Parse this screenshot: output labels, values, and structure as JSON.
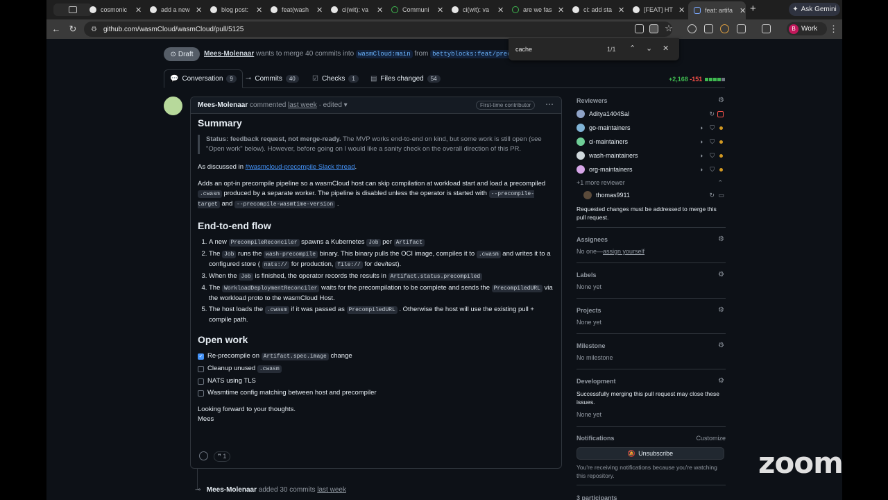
{
  "browser": {
    "tabs": [
      {
        "label": "cosmonic"
      },
      {
        "label": "add a new"
      },
      {
        "label": "blog post:"
      },
      {
        "label": "feat(wash"
      },
      {
        "label": "ci(wit): va"
      },
      {
        "label": "Communi"
      },
      {
        "label": "ci(wit): va"
      },
      {
        "label": "are we fas"
      },
      {
        "label": "ci: add sta"
      },
      {
        "label": "[FEAT] HT"
      },
      {
        "label": "feat: artifa"
      }
    ],
    "gemini_label": "Ask Gemini",
    "url": "github.com/wasmCloud/wasmCloud/pull/5125",
    "profile_initial": "B",
    "profile_label": "Work"
  },
  "find": {
    "query": "cache",
    "count": "1/1"
  },
  "pr": {
    "state": "Draft",
    "author": "Mees-Molenaar",
    "merge_text": "wants to merge 40 commits into",
    "base": "wasmCloud:main",
    "from_text": "from",
    "head": "bettyblocks:feat/precompi",
    "tabs": [
      {
        "label": "Conversation",
        "count": "9",
        "icon": "conversation-icon"
      },
      {
        "label": "Commits",
        "count": "40",
        "icon": "commits-icon"
      },
      {
        "label": "Checks",
        "count": "1",
        "icon": "checks-icon"
      },
      {
        "label": "Files changed",
        "count": "54",
        "icon": "files-icon"
      }
    ],
    "additions": "+2,168",
    "deletions": "-151"
  },
  "comment": {
    "author": "Mees-Molenaar",
    "action": "commented",
    "when": "last week",
    "edited": "· edited",
    "badge": "First-time contributor",
    "summary_title": "Summary",
    "status_bold": "Status: feedback request, not merge-ready.",
    "status_rest": " The MVP works end-to-end on kind, but some work is still open (see \"Open work\" below). However, before going on I would like a sanity check on the overall direction of this PR.",
    "discussed_prefix": "As discussed in ",
    "discussed_link": "#wasmcloud-precompile Slack thread",
    "discussed_suffix": ".",
    "intro_a": "Adds an opt-in precompile pipeline so a wasmCloud host can skip compilation at workload start and load a precompiled ",
    "intro_code1": ".cwasm",
    "intro_b": " produced by a separate worker. The pipeline is disabled unless the operator is started with ",
    "intro_code2": "--precompile-target",
    "intro_c": " and ",
    "intro_code3": "--precompile-wasmtime-version",
    "intro_d": " .",
    "flow_title": "End-to-end flow",
    "flow": {
      "s1a": "A new ",
      "s1c1": "PrecompileReconciler",
      "s1b": " spawns a Kubernetes ",
      "s1c2": "Job",
      "s1d": " per ",
      "s1c3": "Artifact",
      "s2a": "The ",
      "s2c1": "Job",
      "s2b": " runs the ",
      "s2c2": "wash-precompile",
      "s2d": " binary. This binary pulls the OCI image, compiles it to ",
      "s2c3": ".cwasm",
      "s2e": " and writes it to a configured store ( ",
      "s2c4": "nats://",
      "s2f": " for production, ",
      "s2c5": "file://",
      "s2g": " for dev/test).",
      "s3a": "When the ",
      "s3c1": "Job",
      "s3b": " is finished, the operator records the results in ",
      "s3c2": "Artifact.status.precompiled",
      "s4a": "The ",
      "s4c1": "WorkloadDeploymentReconciler",
      "s4b": " waits for the precompilation to be complete and sends the ",
      "s4c2": "PrecompiledURL",
      "s4d": " via the workload proto to the wasmCloud Host.",
      "s5a": "The host loads the ",
      "s5c1": ".cwasm",
      "s5b": " if it was passed as ",
      "s5c2": "PrecompiledURL",
      "s5d": " . Otherwise the host will use the existing pull + compile path."
    },
    "open_title": "Open work",
    "tasks": [
      {
        "pre": "Re-precompile on ",
        "code": "Artifact.spec.image",
        "post": " change",
        "checked": true
      },
      {
        "pre": "Cleanup unused ",
        "code": ".cwasm",
        "post": "",
        "checked": false
      },
      {
        "pre": "NATS using TLS",
        "code": "",
        "post": "",
        "checked": false
      },
      {
        "pre": "Wasmtime config matching between host and precompiler",
        "code": "",
        "post": "",
        "checked": false
      }
    ],
    "closing": "Looking forward to your thoughts.",
    "signoff": "Mees",
    "reaction_count": "1"
  },
  "timeline": {
    "author": "Mees-Molenaar",
    "text": "added 30 commits",
    "when": "last week"
  },
  "sidebar": {
    "reviewers_title": "Reviewers",
    "reviewers": [
      {
        "name": "Aditya1404Sal",
        "color": "#8fa3c7"
      },
      {
        "name": "go-maintainers",
        "color": "#7fb3d5"
      },
      {
        "name": "ci-maintainers",
        "color": "#6fcf97"
      },
      {
        "name": "wash-maintainers",
        "color": "#cfd8dc"
      },
      {
        "name": "org-maintainers",
        "color": "#d7a6e8"
      }
    ],
    "more_reviewer": "+1 more reviewer",
    "extra_reviewer": "thomas9911",
    "changes_note": "Requested changes must be addressed to merge this pull request.",
    "assignees_title": "Assignees",
    "assignees_none": "No one—",
    "assign_yourself": "assign yourself",
    "labels_title": "Labels",
    "labels_val": "None yet",
    "projects_title": "Projects",
    "projects_val": "None yet",
    "milestone_title": "Milestone",
    "milestone_val": "No milestone",
    "development_title": "Development",
    "development_note": "Successfully merging this pull request may close these issues.",
    "development_val": "None yet",
    "notifications_title": "Notifications",
    "customize": "Customize",
    "unsubscribe": "Unsubscribe",
    "notif_note": "You're receiving notifications because you're watching this repository.",
    "participants": "3 participants"
  },
  "overlay": {
    "zoom_logo": "zoom"
  }
}
